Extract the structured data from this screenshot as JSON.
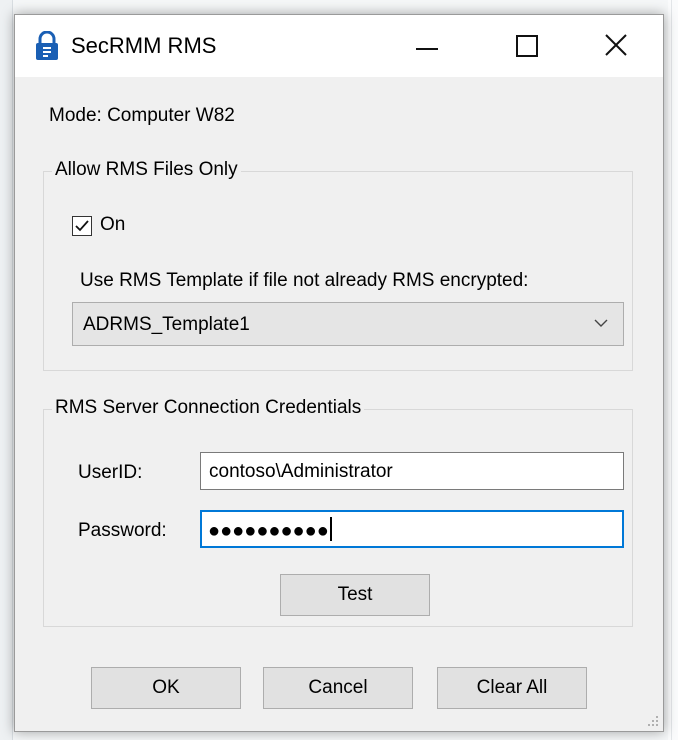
{
  "window": {
    "title": "SecRMM RMS",
    "icon": "lock-shield-icon",
    "controls": [
      "minimize-icon",
      "maximize-icon",
      "close-icon"
    ]
  },
  "mode_label": "Mode: Computer W82",
  "allow_rms": {
    "legend": "Allow RMS Files Only",
    "checkbox_label": "On",
    "checked": true,
    "template_label": "Use RMS Template if file not already RMS encrypted:",
    "template_value": "ADRMS_Template1"
  },
  "credentials": {
    "legend": "RMS Server Connection Credentials",
    "userid_label": "UserID:",
    "userid_value": "contoso\\Administrator",
    "password_label": "Password:",
    "password_value": "●●●●●●●●●●",
    "test_label": "Test"
  },
  "buttons": {
    "ok": "OK",
    "cancel": "Cancel",
    "clear_all": "Clear All"
  },
  "colors": {
    "focus_border": "#0078d7",
    "accent_icon": "#1a5fb4"
  }
}
